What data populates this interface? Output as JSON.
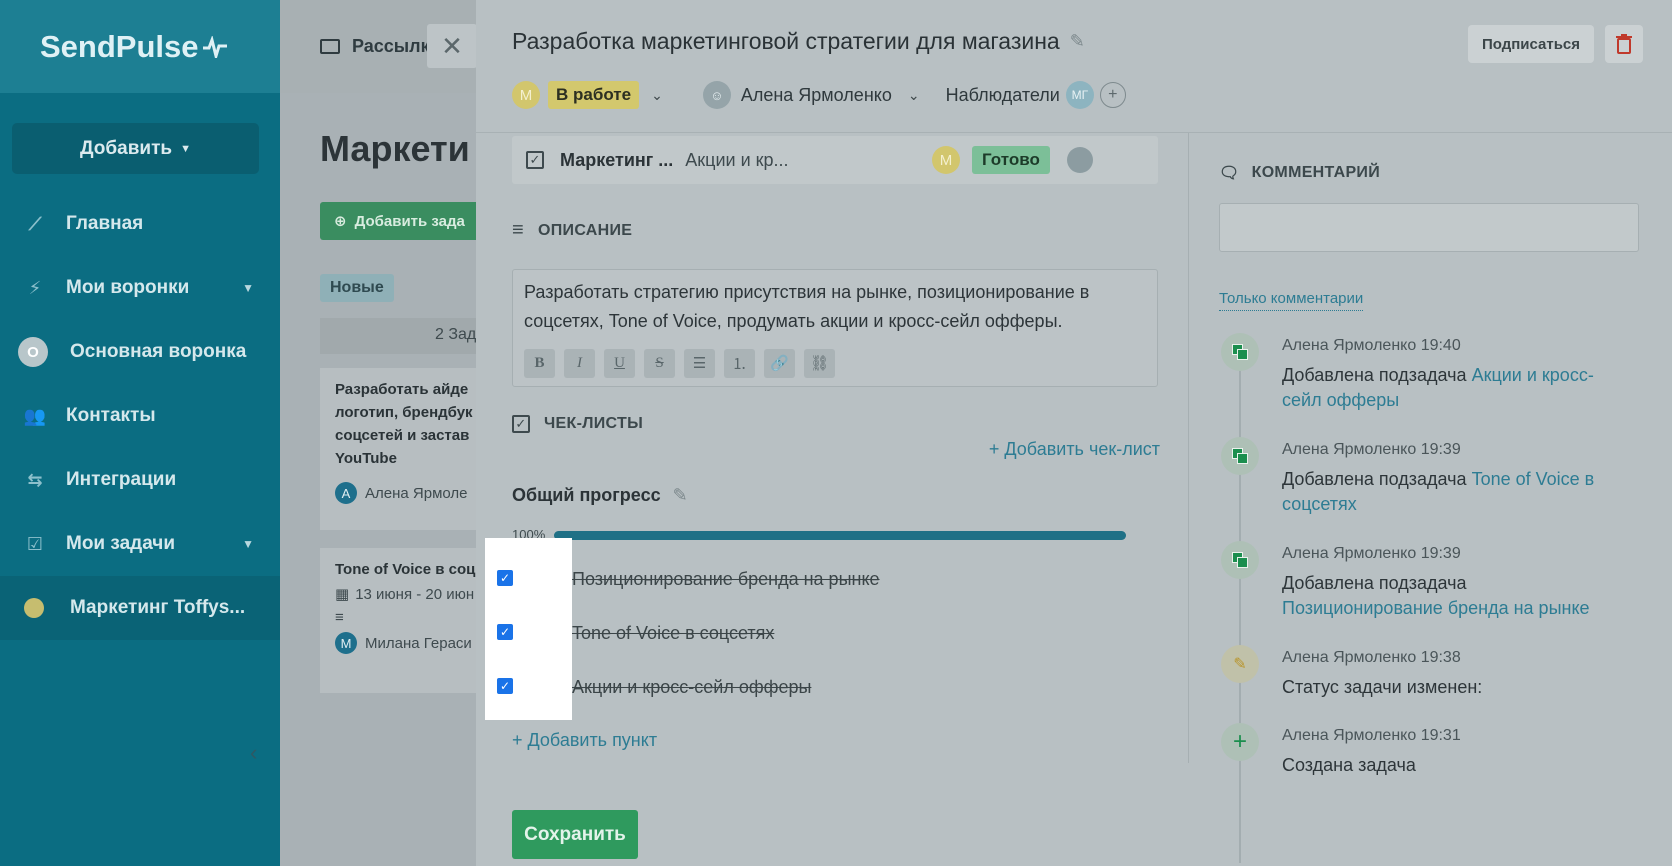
{
  "sidebar": {
    "brand": "SendPulse",
    "add_button": "Добавить",
    "items": [
      {
        "label": "Главная",
        "icon": "chart-line-icon"
      },
      {
        "label": "Мои воронки",
        "icon": "funnel-icon"
      },
      {
        "label": "Основная воронка",
        "icon_text": "О"
      },
      {
        "label": "Контакты",
        "icon": "contacts-icon"
      },
      {
        "label": "Интеграции",
        "icon": "arrows-icon"
      },
      {
        "label": "Мои задачи",
        "icon": "task-check-icon"
      },
      {
        "label": "Маркетинг Toffys..."
      }
    ]
  },
  "board": {
    "tab_label": "Рассылк",
    "title": "Маркети",
    "add_task": "Добавить зада",
    "column_tag": "Новые",
    "column_count": "2 Зад",
    "cards": [
      {
        "title": "Разработать айде логотип, брендбук соцсетей и застав YouTube",
        "avatar": "А",
        "assignee": "Алена Ярмоле"
      },
      {
        "title": "Tone of Voice в соц",
        "date": "13 июня - 20 июн",
        "avatar": "М",
        "assignee": "Милана Гераси"
      }
    ]
  },
  "modal": {
    "title": "Разработка маркетинговой стратегии для магазина",
    "subscribe": "Подписаться",
    "status_avatar": "М",
    "status": "В работе",
    "assignee": "Алена Ярмоленко",
    "observers_label": "Наблюдатели",
    "observer_avatar": "МГ",
    "subtask": {
      "checked": true,
      "name": "Маркетинг ...",
      "desc": "Акции и кр...",
      "avatar": "М",
      "status": "Готово"
    },
    "description": {
      "header": "ОПИСАНИЕ",
      "text": "Разработать стратегию присутствия на рынке, позиционирование в соцсетях, Tone of Voice, продумать акции и кросс-сейл офферы.",
      "tools": [
        "B",
        "I",
        "U",
        "S",
        "bullet-list-icon",
        "numbered-list-icon",
        "link-icon",
        "unlink-icon"
      ]
    },
    "checklists": {
      "header": "ЧЕК-ЛИСТЫ",
      "add_checklist": "+ Добавить чек-лист",
      "progress_title": "Общий прогресс",
      "progress_percent": "100%",
      "progress_value": 1.0,
      "items": [
        {
          "label": "Позиционирование бренда на рынке",
          "checked": true
        },
        {
          "label": "Tone of Voice в соцсетях",
          "checked": true
        },
        {
          "label": "Акции и кросс-сейл офферы",
          "checked": true
        }
      ],
      "add_item": "+ Добавить пункт"
    },
    "save": "Сохранить",
    "comments": {
      "header": "КОММЕНТАРИЙ",
      "filter": "Только комментарии",
      "events": [
        {
          "author": "Алена Ярмоленко",
          "time": "19:40",
          "text": "Добавлена подзадача ",
          "link": "Акции и кросс-сейл офферы",
          "icon": "subtask-icon"
        },
        {
          "author": "Алена Ярмоленко",
          "time": "19:39",
          "text": "Добавлена подзадача ",
          "link": "Tone of Voice в соцсетях",
          "icon": "subtask-icon"
        },
        {
          "author": "Алена Ярмоленко",
          "time": "19:39",
          "text": "Добавлена подзадача ",
          "link": "Позиционирование бренда на рынке",
          "icon": "subtask-icon"
        },
        {
          "author": "Алена Ярмоленко",
          "time": "19:38",
          "text": "Статус задачи изменен:",
          "link": "",
          "icon": "pencil-icon"
        },
        {
          "author": "Алена Ярмоленко",
          "time": "19:31",
          "text": "Создана задача",
          "link": "",
          "icon": "plus-icon"
        }
      ]
    }
  },
  "colors": {
    "sidebar": "#0b6d82",
    "accent": "#2d7c93",
    "save": "#2f9a5e",
    "status_yellow": "#d3c86d",
    "done_green": "#7cbf98"
  }
}
